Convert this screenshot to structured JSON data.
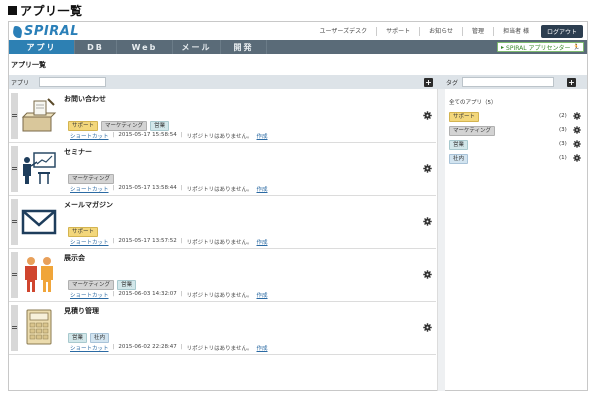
{
  "page": {
    "heading": "アプリ一覧"
  },
  "header": {
    "logo_text": "SPIRAL",
    "links": [
      "ユーザーズデスク",
      "サポート",
      "お知らせ",
      "管理",
      "担当者 様"
    ],
    "logout": "ログアウト"
  },
  "nav": {
    "tabs": [
      "アプリ",
      "DB",
      "Web",
      "メール",
      "開発"
    ],
    "active_tab": "アプリ",
    "app_center": "SPIRAL アプリセンター"
  },
  "main": {
    "section_title": "アプリ一覧",
    "apps_label": "アプリ",
    "apps_search_placeholder": "",
    "add_label": "+",
    "tags_label": "タグ"
  },
  "apps": [
    {
      "name": "お問い合わせ",
      "icon": "inquiry-icon",
      "tags": [
        {
          "label": "サポート",
          "type": "support"
        },
        {
          "label": "マーケティング",
          "type": "marketing"
        },
        {
          "label": "営業",
          "type": "sales"
        }
      ],
      "shortcut": "ショートカット",
      "date": "2015-05-17 15:58:54",
      "repo": "リポジトリはありません。",
      "create": "作成"
    },
    {
      "name": "セミナー",
      "icon": "seminar-icon",
      "tags": [
        {
          "label": "マーケティング",
          "type": "marketing"
        }
      ],
      "shortcut": "ショートカット",
      "date": "2015-05-17 13:58:44",
      "repo": "リポジトリはありません。",
      "create": "作成"
    },
    {
      "name": "メールマガジン",
      "icon": "mail-icon",
      "tags": [
        {
          "label": "サポート",
          "type": "support"
        }
      ],
      "shortcut": "ショートカット",
      "date": "2015-05-17 13:57:52",
      "repo": "リポジトリはありません。",
      "create": "作成"
    },
    {
      "name": "展示会",
      "icon": "exhibition-icon",
      "tags": [
        {
          "label": "マーケティング",
          "type": "marketing"
        },
        {
          "label": "営業",
          "type": "sales"
        }
      ],
      "shortcut": "ショートカット",
      "date": "2015-06-03 14:32:07",
      "repo": "リポジトリはありません。",
      "create": "作成"
    },
    {
      "name": "見積り管理",
      "icon": "calculator-icon",
      "tags": [
        {
          "label": "営業",
          "type": "sales"
        },
        {
          "label": "社内",
          "type": "internal"
        }
      ],
      "shortcut": "ショートカット",
      "date": "2015-06-02 22:28:47",
      "repo": "リポジトリはありません。",
      "create": "作成"
    }
  ],
  "sidebar": {
    "all_apps": "全てのアプリ（5）",
    "tags": [
      {
        "label": "サポート",
        "type": "support",
        "count": "(2)"
      },
      {
        "label": "マーケティング",
        "type": "marketing",
        "count": "(3)"
      },
      {
        "label": "営業",
        "type": "sales",
        "count": "(3)"
      },
      {
        "label": "社内",
        "type": "internal",
        "count": "(1)"
      }
    ]
  },
  "colors": {
    "brand": "#2a7fb8",
    "tab_bar": "#5a6b78",
    "active_tab": "#2d80b3",
    "logout": "#2c3e50"
  }
}
